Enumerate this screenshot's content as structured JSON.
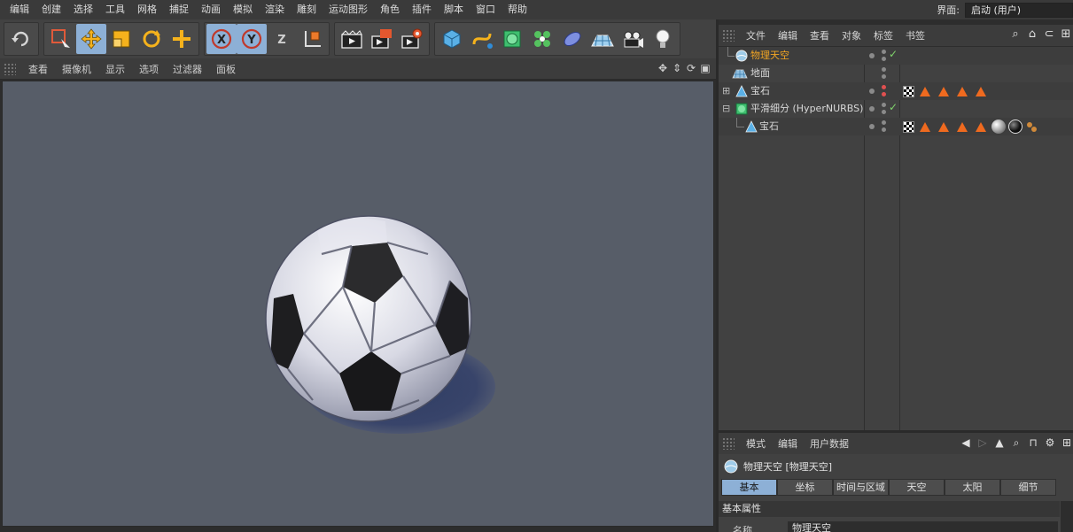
{
  "menubar": {
    "items": [
      "编辑",
      "创建",
      "选择",
      "工具",
      "网格",
      "捕捉",
      "动画",
      "模拟",
      "渲染",
      "雕刻",
      "运动图形",
      "角色",
      "插件",
      "脚本",
      "窗口",
      "帮助"
    ],
    "layout_label": "界面:",
    "layout_value": "启动 (用户)"
  },
  "toolbar": {
    "icons": [
      "undo-icon",
      "live-selection-icon",
      "move-icon",
      "scale-icon",
      "rotate-icon",
      "add-icon",
      "x-axis-icon",
      "y-axis-icon",
      "z-axis-icon",
      "coordinate-system-icon",
      "render-view-icon",
      "render-to-picture-viewer-icon",
      "render-settings-icon",
      "cube-icon",
      "spline-pen-icon",
      "subdivision-surface-icon",
      "cloner-icon",
      "deformer-icon",
      "floor-icon",
      "camera-icon",
      "light-icon"
    ]
  },
  "viewport": {
    "menu": [
      "查看",
      "摄像机",
      "显示",
      "选项",
      "过滤器",
      "面板"
    ]
  },
  "object_manager": {
    "menu": [
      "文件",
      "编辑",
      "查看",
      "对象",
      "标签",
      "书签"
    ],
    "objects": [
      {
        "name": "物理天空",
        "selected": true
      },
      {
        "name": "地面",
        "selected": false
      },
      {
        "name": "宝石",
        "selected": false
      },
      {
        "name": "平滑细分 (HyperNURBS)",
        "selected": false
      },
      {
        "name": "宝石",
        "selected": false
      }
    ]
  },
  "attribute_manager": {
    "menu": [
      "模式",
      "编辑",
      "用户数据"
    ],
    "title": "物理天空 [物理天空]",
    "tabs": [
      "基本",
      "坐标",
      "时间与区域",
      "天空",
      "太阳",
      "细节"
    ],
    "active_tab": "基本",
    "section": "基本属性",
    "field_label": "名称",
    "field_value": "物理天空"
  },
  "colors": {
    "accent": "#8db0d6",
    "selected_text": "#f3a623",
    "tag_orange": "#ef6a1f",
    "viewport_bg": "#575d68"
  }
}
